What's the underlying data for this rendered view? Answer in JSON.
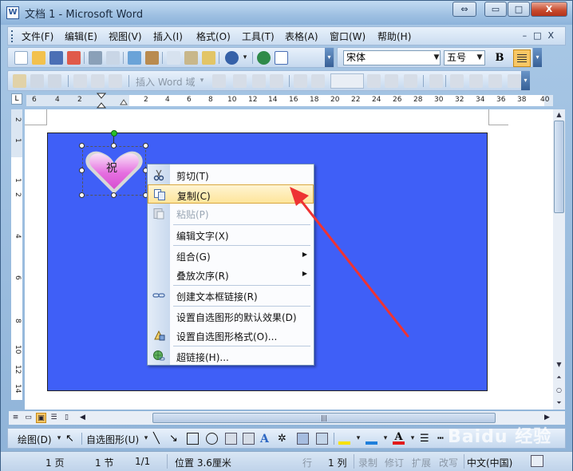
{
  "window": {
    "title": "文档 1 - Microsoft Word",
    "app_icon": "W"
  },
  "caption_buttons": {
    "restore_alt": "⇔",
    "minimize": "▭",
    "maximize": "□",
    "close": "X"
  },
  "menubar": {
    "items": [
      "文件(F)",
      "编辑(E)",
      "视图(V)",
      "插入(I)",
      "格式(O)",
      "工具(T)",
      "表格(A)",
      "窗口(W)",
      "帮助(H)"
    ],
    "mdi_controls": "–□X"
  },
  "format_toolbar": {
    "font_name": "宋体",
    "font_size": "五号",
    "bold": "B"
  },
  "mailmerge_toolbar": {
    "insert_field": "插入 Word 域"
  },
  "ruler": {
    "h_ticks": [
      "6",
      "4",
      "2",
      "2",
      "4",
      "6",
      "8",
      "10",
      "12",
      "14",
      "16",
      "18",
      "20",
      "22",
      "24",
      "26",
      "28",
      "30",
      "32",
      "34",
      "36",
      "38",
      "40"
    ],
    "v_ticks": [
      "2",
      "1",
      "1",
      "2",
      "4",
      "6",
      "8",
      "10",
      "12",
      "14"
    ],
    "corner": "L"
  },
  "shape": {
    "text": "祝"
  },
  "context_menu": {
    "items": [
      {
        "label": "剪切(T)",
        "icon": "scissors-icon",
        "disabled": false
      },
      {
        "label": "复制(C)",
        "icon": "copy-icon",
        "disabled": false,
        "highlighted": true
      },
      {
        "label": "粘贴(P)",
        "icon": "paste-icon",
        "disabled": true
      },
      {
        "label": "编辑文字(X)",
        "disabled": false
      },
      {
        "label": "组合(G)",
        "submenu": true
      },
      {
        "label": "叠放次序(R)",
        "submenu": true
      },
      {
        "label": "创建文本框链接(R)",
        "icon": "link-icon"
      },
      {
        "label": "设置自选图形的默认效果(D)"
      },
      {
        "label": "设置自选图形格式(O)...",
        "icon": "format-shape-icon"
      },
      {
        "label": "超链接(H)...",
        "icon": "hyperlink-globe-icon"
      }
    ],
    "submenu_arrow": "▶"
  },
  "drawing_toolbar": {
    "draw_label": "绘图(D)",
    "autoshapes_label": "自选图形(U)"
  },
  "statusbar": {
    "page": "1 页",
    "section": "1 节",
    "page_of": "1/1",
    "position": "位置 3.6厘米",
    "line": "行",
    "column": "1 列",
    "rec": "录制",
    "trk": "修订",
    "ext": "扩展",
    "ovr": "改写",
    "language": "中文(中国)"
  },
  "watermark": "Baidu 经验",
  "colors": {
    "canvas_blue": "#3f5ff7",
    "highlight": "#fde59b",
    "arrow_red": "#ee3333"
  }
}
